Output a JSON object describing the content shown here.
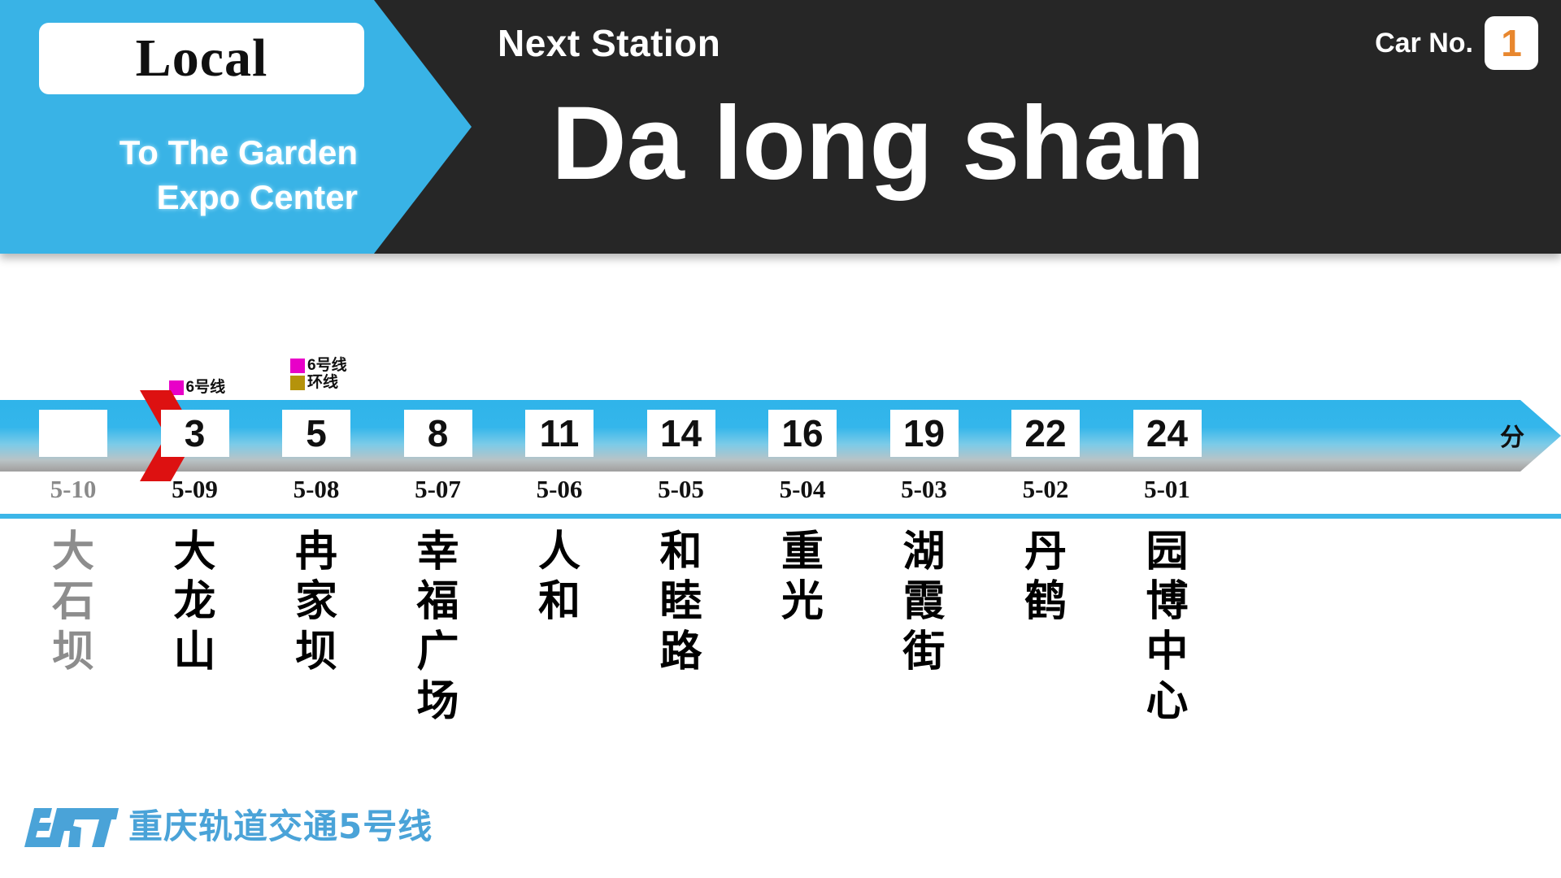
{
  "header": {
    "service_type": "Local",
    "destination_line1": "To The Garden",
    "destination_line2": "Expo Center",
    "next_station_label": "Next Station",
    "next_station_name": "Da long shan",
    "car_no_label": "Car No.",
    "car_no_value": "1",
    "bg_color": "#262626",
    "accent_color": "#39b3e6",
    "car_no_color": "#e8872e"
  },
  "legends": [
    {
      "at_station_index": 1,
      "lines": [
        {
          "name": "6号线",
          "color": "#e800c8"
        }
      ]
    },
    {
      "at_station_index": 2,
      "lines": [
        {
          "name": "6号线",
          "color": "#e800c8"
        },
        {
          "name": "环线",
          "color": "#b5930b"
        }
      ]
    }
  ],
  "route": {
    "minute_unit": "分",
    "chevron_color": "#dd1111",
    "strip_color_top": "#2fb4ea",
    "strip_color_bottom": "#9e9e9e",
    "separator_color": "#3cb6e8",
    "stations": [
      {
        "minutes": "",
        "code": "5-10",
        "name_cn": "大石坝",
        "chars": [
          "大",
          "石",
          "坝"
        ],
        "passed": true
      },
      {
        "minutes": "3",
        "code": "5-09",
        "name_cn": "大龙山",
        "chars": [
          "大",
          "龙",
          "山"
        ],
        "passed": false
      },
      {
        "minutes": "5",
        "code": "5-08",
        "name_cn": "冉家坝",
        "chars": [
          "冉",
          "家",
          "坝"
        ],
        "passed": false
      },
      {
        "minutes": "8",
        "code": "5-07",
        "name_cn": "幸福广场",
        "chars": [
          "幸",
          "福",
          "广",
          "场"
        ],
        "passed": false
      },
      {
        "minutes": "11",
        "code": "5-06",
        "name_cn": "人和",
        "chars": [
          "人",
          "和"
        ],
        "passed": false
      },
      {
        "minutes": "14",
        "code": "5-05",
        "name_cn": "和睦路",
        "chars": [
          "和",
          "睦",
          "路"
        ],
        "passed": false
      },
      {
        "minutes": "16",
        "code": "5-04",
        "name_cn": "重光",
        "chars": [
          "重",
          "光"
        ],
        "passed": false
      },
      {
        "minutes": "19",
        "code": "5-03",
        "name_cn": "湖霞街",
        "chars": [
          "湖",
          "霞",
          "街"
        ],
        "passed": false
      },
      {
        "minutes": "22",
        "code": "5-02",
        "name_cn": "丹鹤",
        "chars": [
          "丹",
          "鹤"
        ],
        "passed": false
      },
      {
        "minutes": "24",
        "code": "5-01",
        "name_cn": "园博中心",
        "chars": [
          "园",
          "博",
          "中",
          "心"
        ],
        "passed": false
      }
    ]
  },
  "footer": {
    "operator_text": "重庆轨道交通5号线",
    "logo_name": "crt-logo",
    "logo_color": "#4aa3d8"
  }
}
